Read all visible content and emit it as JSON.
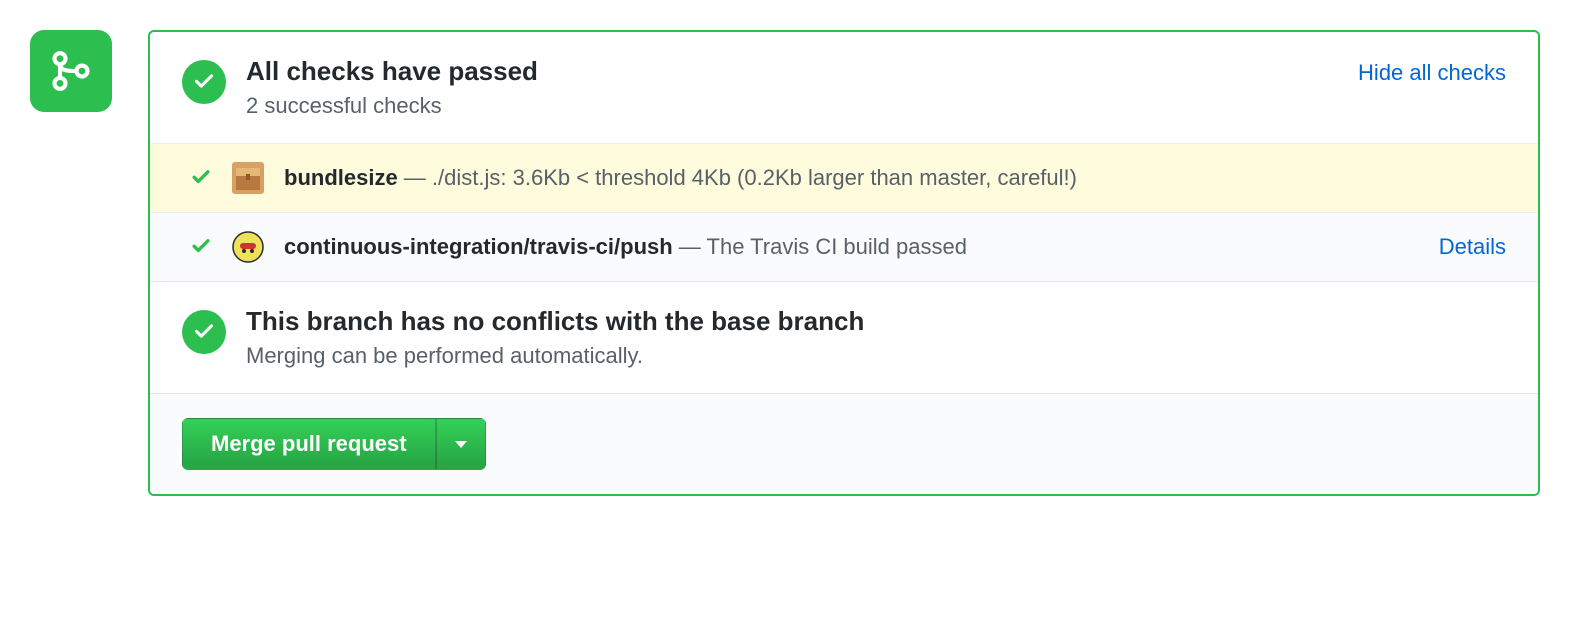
{
  "header": {
    "title": "All checks have passed",
    "subtitle": "2 successful checks",
    "hide_link": "Hide all checks"
  },
  "checks": [
    {
      "name": "bundlesize",
      "separator": " — ",
      "description": "./dist.js: 3.6Kb < threshold 4Kb (0.2Kb larger than master, careful!)",
      "details_label": "",
      "highlight": true,
      "avatar_bg": "#c08040"
    },
    {
      "name": "continuous-integration/travis-ci/push",
      "separator": " — ",
      "description": "The Travis CI build passed",
      "details_label": "Details",
      "highlight": false,
      "avatar_bg": "#cfa54a"
    }
  ],
  "conflicts": {
    "title": "This branch has no conflicts with the base branch",
    "subtitle": "Merging can be performed automatically."
  },
  "merge": {
    "button_label": "Merge pull request"
  },
  "colors": {
    "success": "#2cbe4e",
    "link": "#0366d6",
    "highlight_bg": "#fffbdd"
  }
}
